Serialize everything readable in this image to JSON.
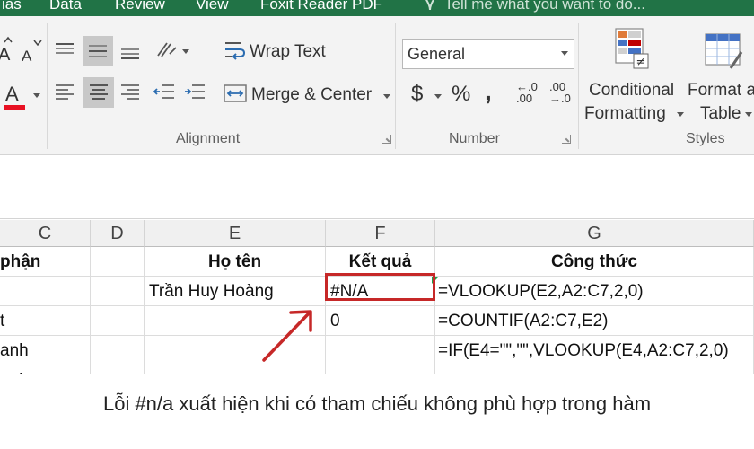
{
  "ribbon_tabs": [
    "ias",
    "Data",
    "Review",
    "View",
    "Foxit Reader PDF"
  ],
  "tell_me": "Tell me what you want to do...",
  "alignment": {
    "wrap_text": "Wrap Text",
    "merge_center": "Merge & Center",
    "group_label": "Alignment"
  },
  "number": {
    "format": "General",
    "currency": "$",
    "percent": "%",
    "comma": ",",
    "inc_decimal": "←.0\n.00",
    "dec_decimal": ".00\n→.0",
    "group_label": "Number"
  },
  "styles": {
    "conditional_1": "Conditional",
    "conditional_2": "Formatting",
    "format_as_1": "Format a",
    "format_as_2": "Table",
    "group_label": "Styles"
  },
  "font_letters": {
    "grow": "A",
    "shrink": "A",
    "color": "A"
  },
  "columns": [
    "C",
    "D",
    "E",
    "F",
    "G"
  ],
  "rows": [
    [
      "phận",
      "",
      "Họ tên",
      "Kết quả",
      "Công thức"
    ],
    [
      "",
      "",
      "Trần Huy Hoàng",
      "#N/A",
      "=VLOOKUP(E2,A2:C7,2,0)"
    ],
    [
      "t",
      "",
      "",
      "0",
      "=COUNTIF(A2:C7,E2)"
    ],
    [
      "anh",
      "",
      "",
      "",
      "=IF(E4=\"\",\"\",VLOOKUP(E4,A2:C7,2,0)"
    ],
    [
      "anh",
      "",
      "",
      "",
      ""
    ]
  ],
  "colors": {
    "ribbon_green": "#217346",
    "error_border": "#c62828",
    "font_red": "#e81123"
  },
  "caption": "Lỗi #n/a xuất hiện khi có tham chiếu không phù hợp trong hàm"
}
